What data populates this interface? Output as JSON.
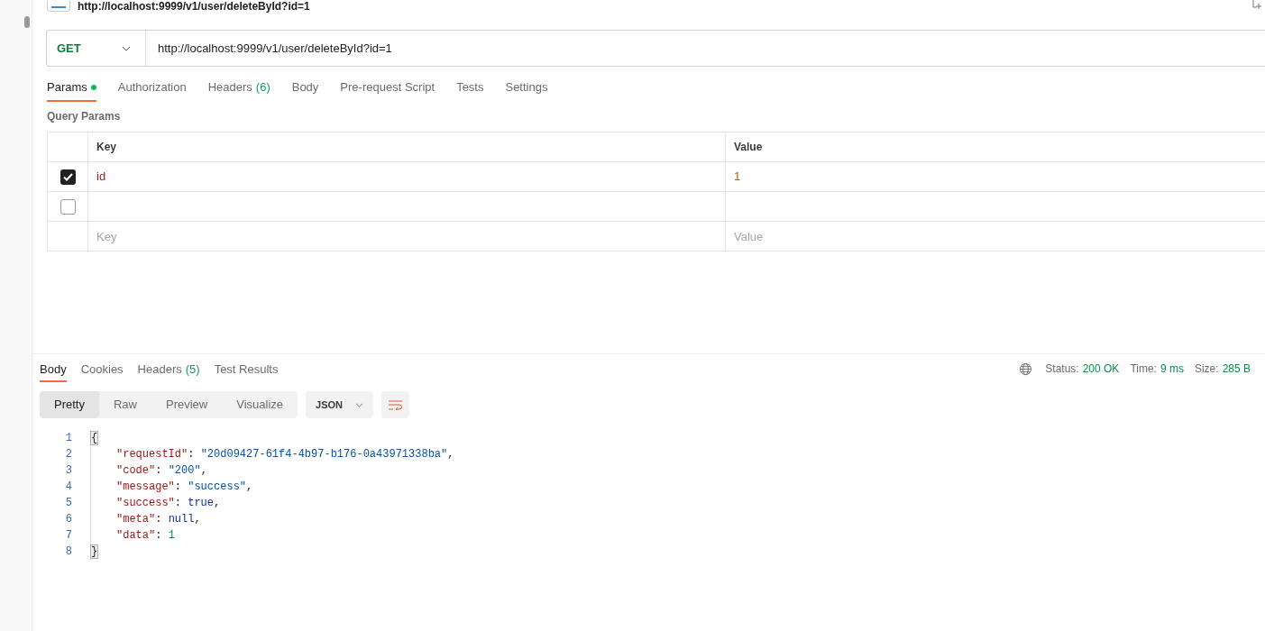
{
  "request": {
    "title": "http://localhost:9999/v1/user/deleteById?id=1",
    "method": "GET",
    "url": "http://localhost:9999/v1/user/deleteById?id=1"
  },
  "request_tabs": [
    {
      "label": "Params",
      "dot": true,
      "selected": true
    },
    {
      "label": "Authorization",
      "dot": false,
      "selected": false
    },
    {
      "label": "Headers",
      "count": "(6)",
      "dot": false,
      "selected": false
    },
    {
      "label": "Body",
      "dot": false,
      "selected": false
    },
    {
      "label": "Pre-request Script",
      "dot": false,
      "selected": false
    },
    {
      "label": "Tests",
      "dot": false,
      "selected": false
    },
    {
      "label": "Settings",
      "dot": false,
      "selected": false
    }
  ],
  "query_params": {
    "title": "Query Params",
    "columns": [
      "Key",
      "Value"
    ],
    "rows": [
      {
        "checked": true,
        "key": "id",
        "value": "1"
      },
      {
        "checked": false
      }
    ],
    "new_row": {
      "key_placeholder": "Key",
      "value_placeholder": "Value"
    }
  },
  "response_tabs": [
    {
      "label": "Body",
      "selected": true
    },
    {
      "label": "Cookies",
      "selected": false
    },
    {
      "label": "Headers",
      "count": "(5)",
      "selected": false
    },
    {
      "label": "Test Results",
      "selected": false
    }
  ],
  "status": [
    {
      "label": "Status:",
      "value": "200 OK"
    },
    {
      "label": "Time:",
      "value": "9 ms"
    },
    {
      "label": "Size:",
      "value": "285 B"
    }
  ],
  "views": [
    {
      "label": "Pretty",
      "selected": true
    },
    {
      "label": "Raw",
      "selected": false
    },
    {
      "label": "Preview",
      "selected": false
    },
    {
      "label": "Visualize",
      "selected": false
    }
  ],
  "format": "JSON",
  "code_lines": [
    {
      "number": "1",
      "indented": false,
      "tokens": [
        {
          "kind": "bracket",
          "text": "{"
        }
      ]
    },
    {
      "number": "2",
      "indented": true,
      "tokens": [
        {
          "kind": "key",
          "text": "\"requestId\""
        },
        {
          "kind": "punct",
          "text": ": "
        },
        {
          "kind": "string",
          "text": "\"20d09427-61f4-4b97-b176-0a43971338ba\""
        },
        {
          "kind": "punct",
          "text": ","
        }
      ]
    },
    {
      "number": "3",
      "indented": true,
      "tokens": [
        {
          "kind": "key",
          "text": "\"code\""
        },
        {
          "kind": "punct",
          "text": ": "
        },
        {
          "kind": "string",
          "text": "\"200\""
        },
        {
          "kind": "punct",
          "text": ","
        }
      ]
    },
    {
      "number": "4",
      "indented": true,
      "tokens": [
        {
          "kind": "key",
          "text": "\"message\""
        },
        {
          "kind": "punct",
          "text": ": "
        },
        {
          "kind": "string",
          "text": "\"success\""
        },
        {
          "kind": "punct",
          "text": ","
        }
      ]
    },
    {
      "number": "5",
      "indented": true,
      "tokens": [
        {
          "kind": "key",
          "text": "\"success\""
        },
        {
          "kind": "punct",
          "text": ": "
        },
        {
          "kind": "keyword",
          "text": "true"
        },
        {
          "kind": "punct",
          "text": ","
        }
      ]
    },
    {
      "number": "6",
      "indented": true,
      "tokens": [
        {
          "kind": "key",
          "text": "\"meta\""
        },
        {
          "kind": "punct",
          "text": ": "
        },
        {
          "kind": "keyword",
          "text": "null"
        },
        {
          "kind": "punct",
          "text": ","
        }
      ]
    },
    {
      "number": "7",
      "indented": true,
      "tokens": [
        {
          "kind": "key",
          "text": "\"data\""
        },
        {
          "kind": "punct",
          "text": ": "
        },
        {
          "kind": "number",
          "text": "1"
        }
      ]
    },
    {
      "number": "8",
      "indented": false,
      "tokens": [
        {
          "kind": "bracket",
          "text": "}"
        }
      ]
    }
  ]
}
